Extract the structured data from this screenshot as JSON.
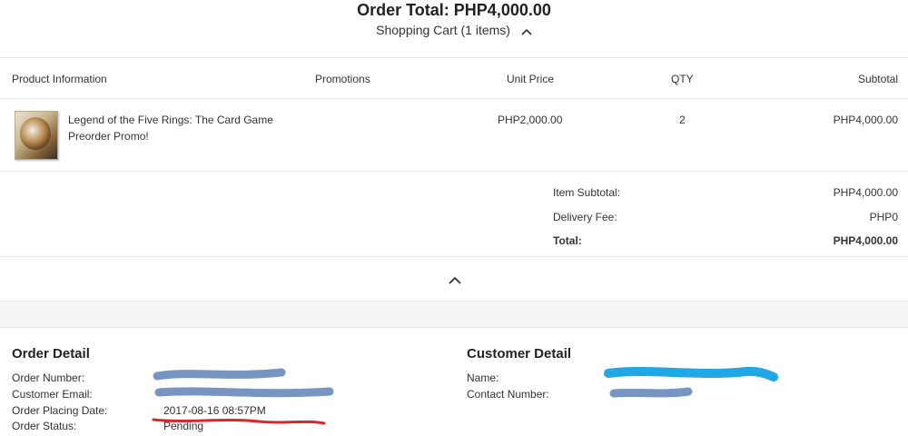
{
  "header": {
    "order_total": "Order Total: PHP4,000.00",
    "cart_summary": "Shopping Cart (1 items)"
  },
  "table": {
    "headers": [
      "Product Information",
      "Promotions",
      "Unit Price",
      "QTY",
      "Subtotal"
    ],
    "rows": [
      {
        "product_name_line1": "Legend of the Five Rings: The Card Game",
        "product_name_line2": "Preorder Promo!",
        "promotions": "",
        "unit_price": "PHP2,000.00",
        "qty": "2",
        "subtotal": "PHP4,000.00"
      }
    ]
  },
  "totals": {
    "item_subtotal_label": "Item Subtotal:",
    "item_subtotal_value": "PHP4,000.00",
    "delivery_fee_label": "Delivery Fee:",
    "delivery_fee_value": "PHP0",
    "total_label": "Total:",
    "total_value": "PHP4,000.00"
  },
  "order_detail": {
    "title": "Order Detail",
    "order_number_label": "Order Number:",
    "customer_email_label": "Customer Email:",
    "placing_date_label": "Order Placing Date:",
    "placing_date_value": "2017-08-16 08:57PM",
    "status_label": "Order Status:",
    "status_value": "Pending"
  },
  "customer_detail": {
    "title": "Customer Detail",
    "name_label": "Name:",
    "contact_label": "Contact Number:"
  },
  "icons": {
    "collapse_cart": "chevron-up-icon",
    "collapse_summary": "chevron-up-icon"
  },
  "colors": {
    "redaction_blue_gray": "#6f8fbf",
    "redaction_cyan": "#1fa7e6",
    "redaction_red": "#d9262b"
  }
}
